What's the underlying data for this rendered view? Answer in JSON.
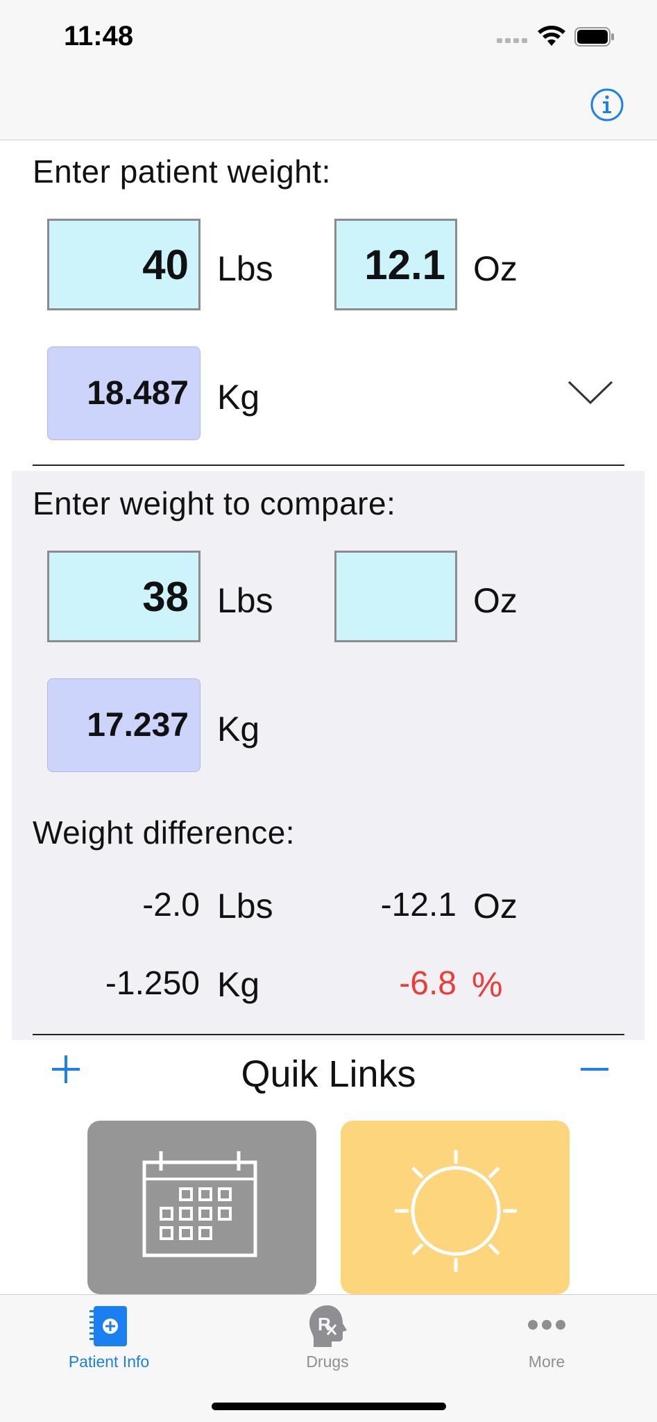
{
  "status_bar": {
    "time": "11:48"
  },
  "patient": {
    "title": "Enter patient weight:",
    "lbs_value": "40",
    "lbs_unit": "Lbs",
    "oz_value": "12.1",
    "oz_unit": "Oz",
    "kg_value": "18.487",
    "kg_unit": "Kg"
  },
  "compare": {
    "title": "Enter weight to compare:",
    "lbs_value": "38",
    "lbs_unit": "Lbs",
    "oz_value": "",
    "oz_unit": "Oz",
    "kg_value": "17.237",
    "kg_unit": "Kg"
  },
  "difference": {
    "title": "Weight difference:",
    "lbs_value": "-2.0",
    "lbs_unit": "Lbs",
    "oz_value": "-12.1",
    "oz_unit": "Oz",
    "kg_value": "-1.250",
    "kg_unit": "Kg",
    "pct_value": "-6.8",
    "pct_unit": "%",
    "pct_color": "#ef3b36"
  },
  "quik_links": {
    "title": "Quik Links",
    "tiles": [
      {
        "icon": "calendar-icon",
        "color": "#969696"
      },
      {
        "icon": "sun-icon",
        "color": "#fcd57c"
      }
    ]
  },
  "tabbar": {
    "tabs": [
      {
        "label": "Patient Info",
        "icon": "patient-info-icon",
        "active": true
      },
      {
        "label": "Drugs",
        "icon": "rx-head-icon",
        "active": false
      },
      {
        "label": "More",
        "icon": "more-icon",
        "active": false
      }
    ],
    "active_color": "#1a7ff0",
    "inactive_color": "#8e8e93"
  },
  "accent_color": "#1a7ff0"
}
